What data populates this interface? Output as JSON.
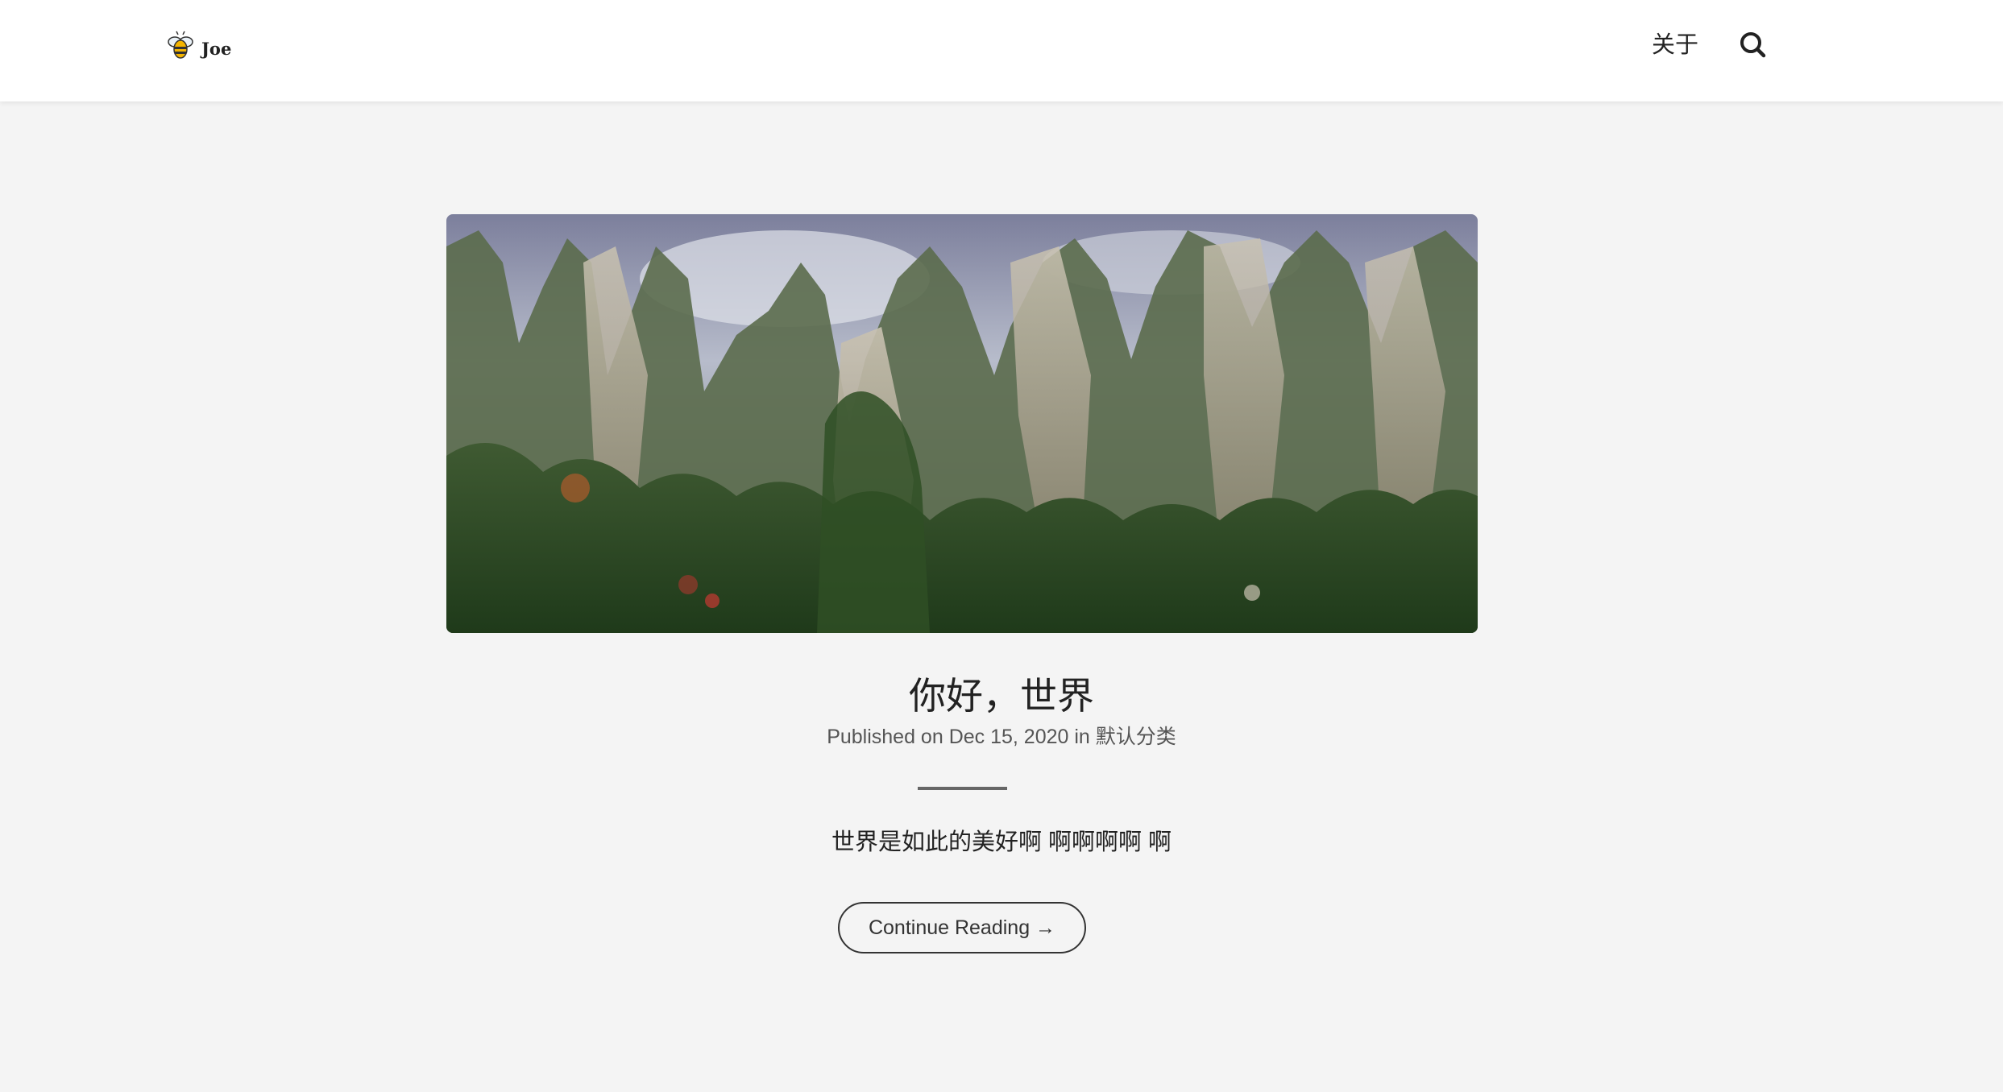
{
  "header": {
    "logo_text": "Joe",
    "nav_about": "关于",
    "search_icon": "search-icon"
  },
  "post": {
    "cover_alt": "你好，世界",
    "title": "你好，世界",
    "meta": {
      "published_prefix": "Published on ",
      "date": "Dec 15, 2020",
      "in_word": " in ",
      "category": "默认分类"
    },
    "excerpt": "世界是如此的美好啊 啊啊啊啊 啊",
    "continue_label": "Continue Reading →"
  },
  "colors": {
    "page_background": "#f4f4f4",
    "header_background": "#ffffff",
    "text": "#222222",
    "meta_text": "#555555",
    "divider": "#666666"
  }
}
